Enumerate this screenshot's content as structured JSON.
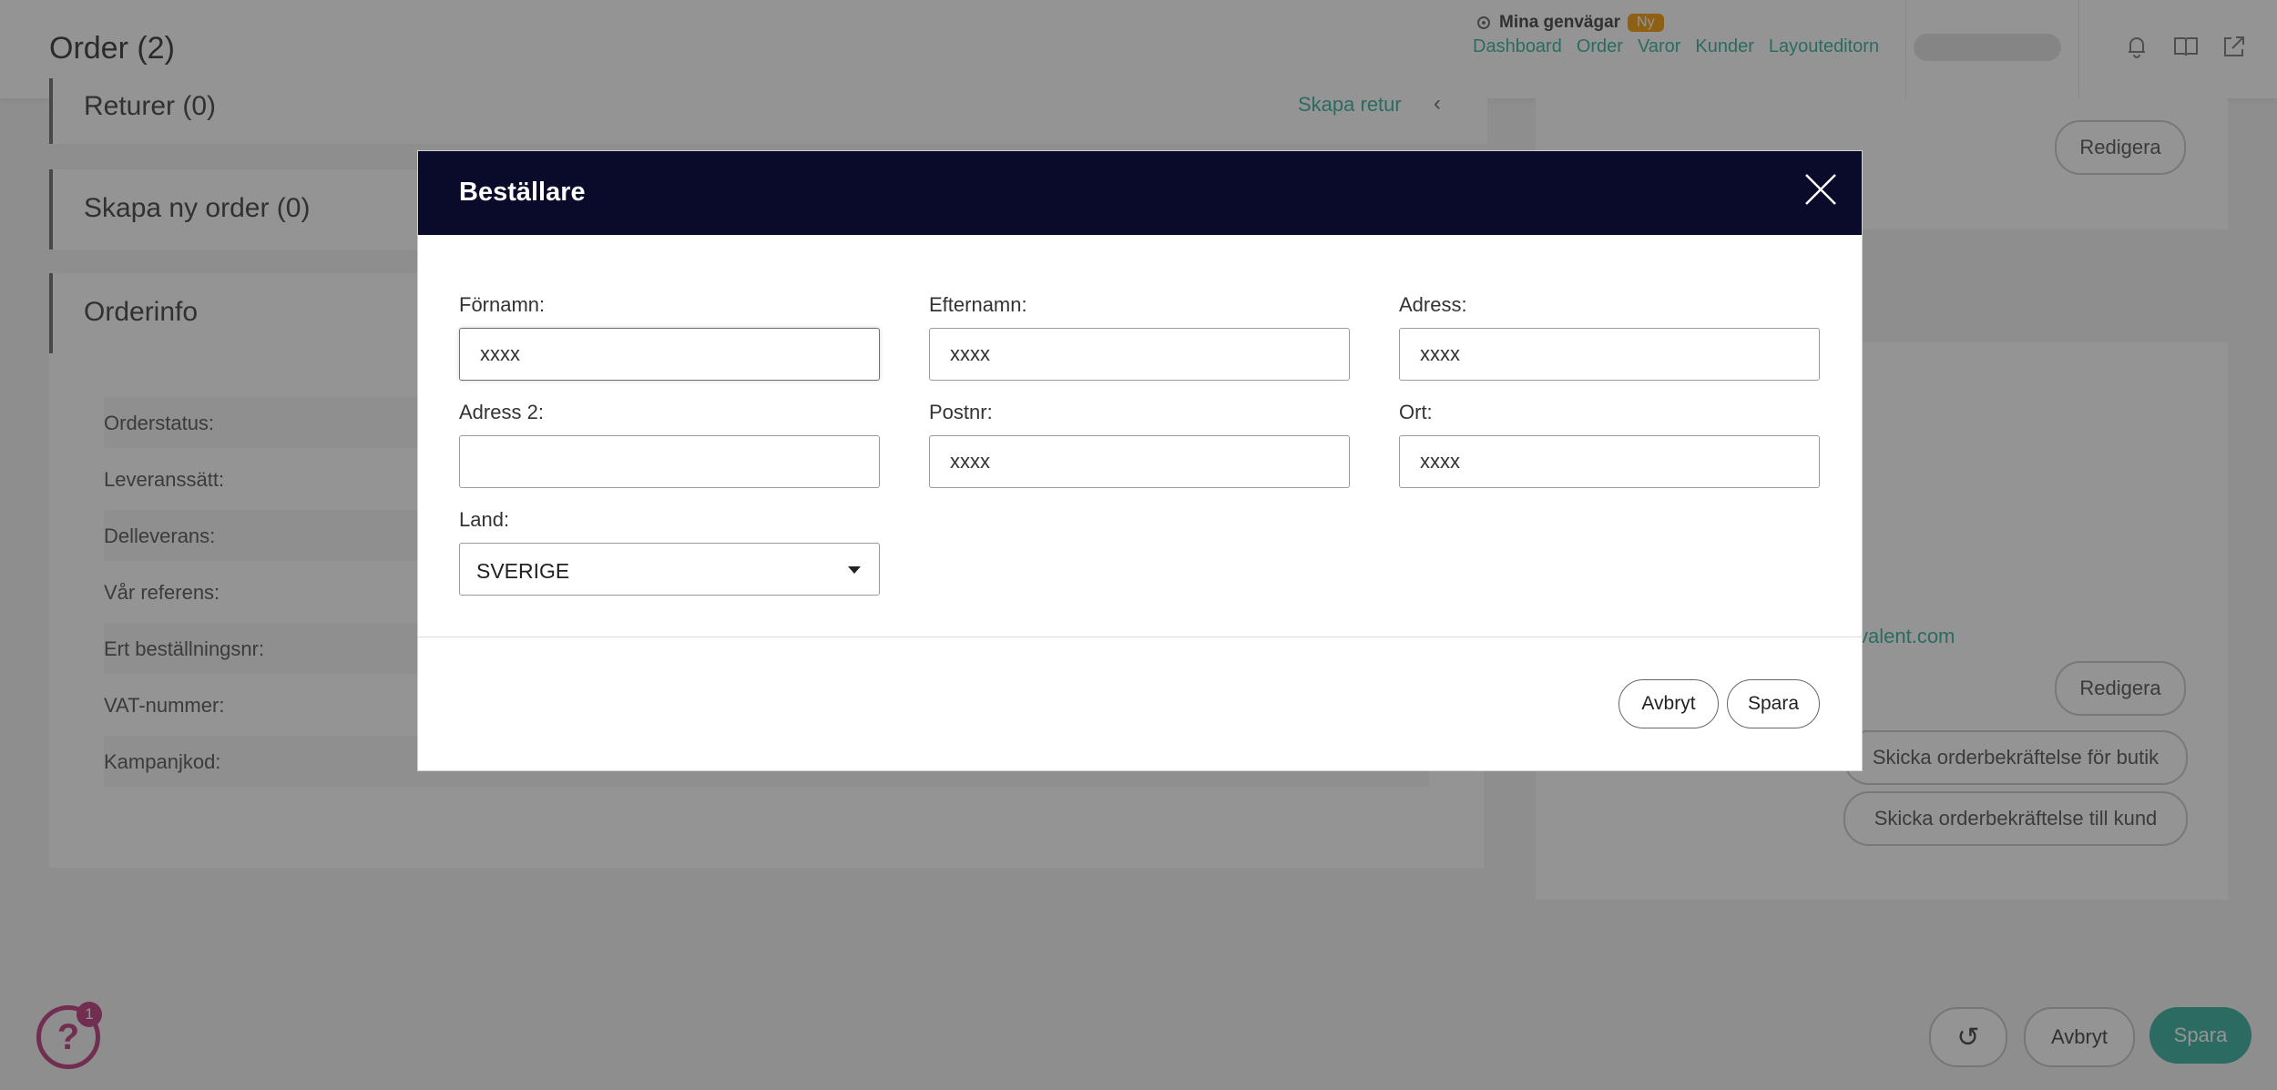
{
  "page": {
    "title": "Order (2)"
  },
  "shortcuts": {
    "title": "Mina genvägar",
    "badge": "Ny",
    "links": [
      "Dashboard",
      "Order",
      "Varor",
      "Kunder",
      "Layouteditorn"
    ]
  },
  "sections": {
    "returns_title": "Returer (0)",
    "create_return": "Skapa retur",
    "new_order_title": "Skapa ny order (0)",
    "orderinfo_title": "Orderinfo",
    "orderinfo_labels": [
      "Orderstatus:",
      "Leveranssätt:",
      "Delleverans:",
      "Vår referens:",
      "Ert beställningsnr:",
      "VAT-nummer:",
      "Kampanjkod:"
    ]
  },
  "right_panel": {
    "edit_label": "Redigera",
    "email_fragment": "valent.com",
    "send_store_confirmation": "Skicka orderbekräftelse för butik",
    "send_customer_confirmation": "Skicka orderbekräftelse till kund"
  },
  "help": {
    "icon_glyph": "?",
    "badge_count": "1"
  },
  "bottom_actions": {
    "cancel": "Avbryt",
    "save": "Spara"
  },
  "modal": {
    "title": "Beställare",
    "fields": {
      "first_name": {
        "label": "Förnamn:",
        "value": "xxxx"
      },
      "last_name": {
        "label": "Efternamn:",
        "value": "xxxx"
      },
      "address": {
        "label": "Adress:",
        "value": "xxxx"
      },
      "address2": {
        "label": "Adress 2:",
        "value": ""
      },
      "postal_code": {
        "label": "Postnr:",
        "value": "xxxx"
      },
      "city": {
        "label": "Ort:",
        "value": "xxxx"
      },
      "country": {
        "label": "Land:",
        "value": "SVERIGE"
      }
    },
    "cancel_label": "Avbryt",
    "save_label": "Spara"
  },
  "colors": {
    "modal_header": "#0a0b2b",
    "accent": "#4cb8a8",
    "help": "#c4508a"
  }
}
